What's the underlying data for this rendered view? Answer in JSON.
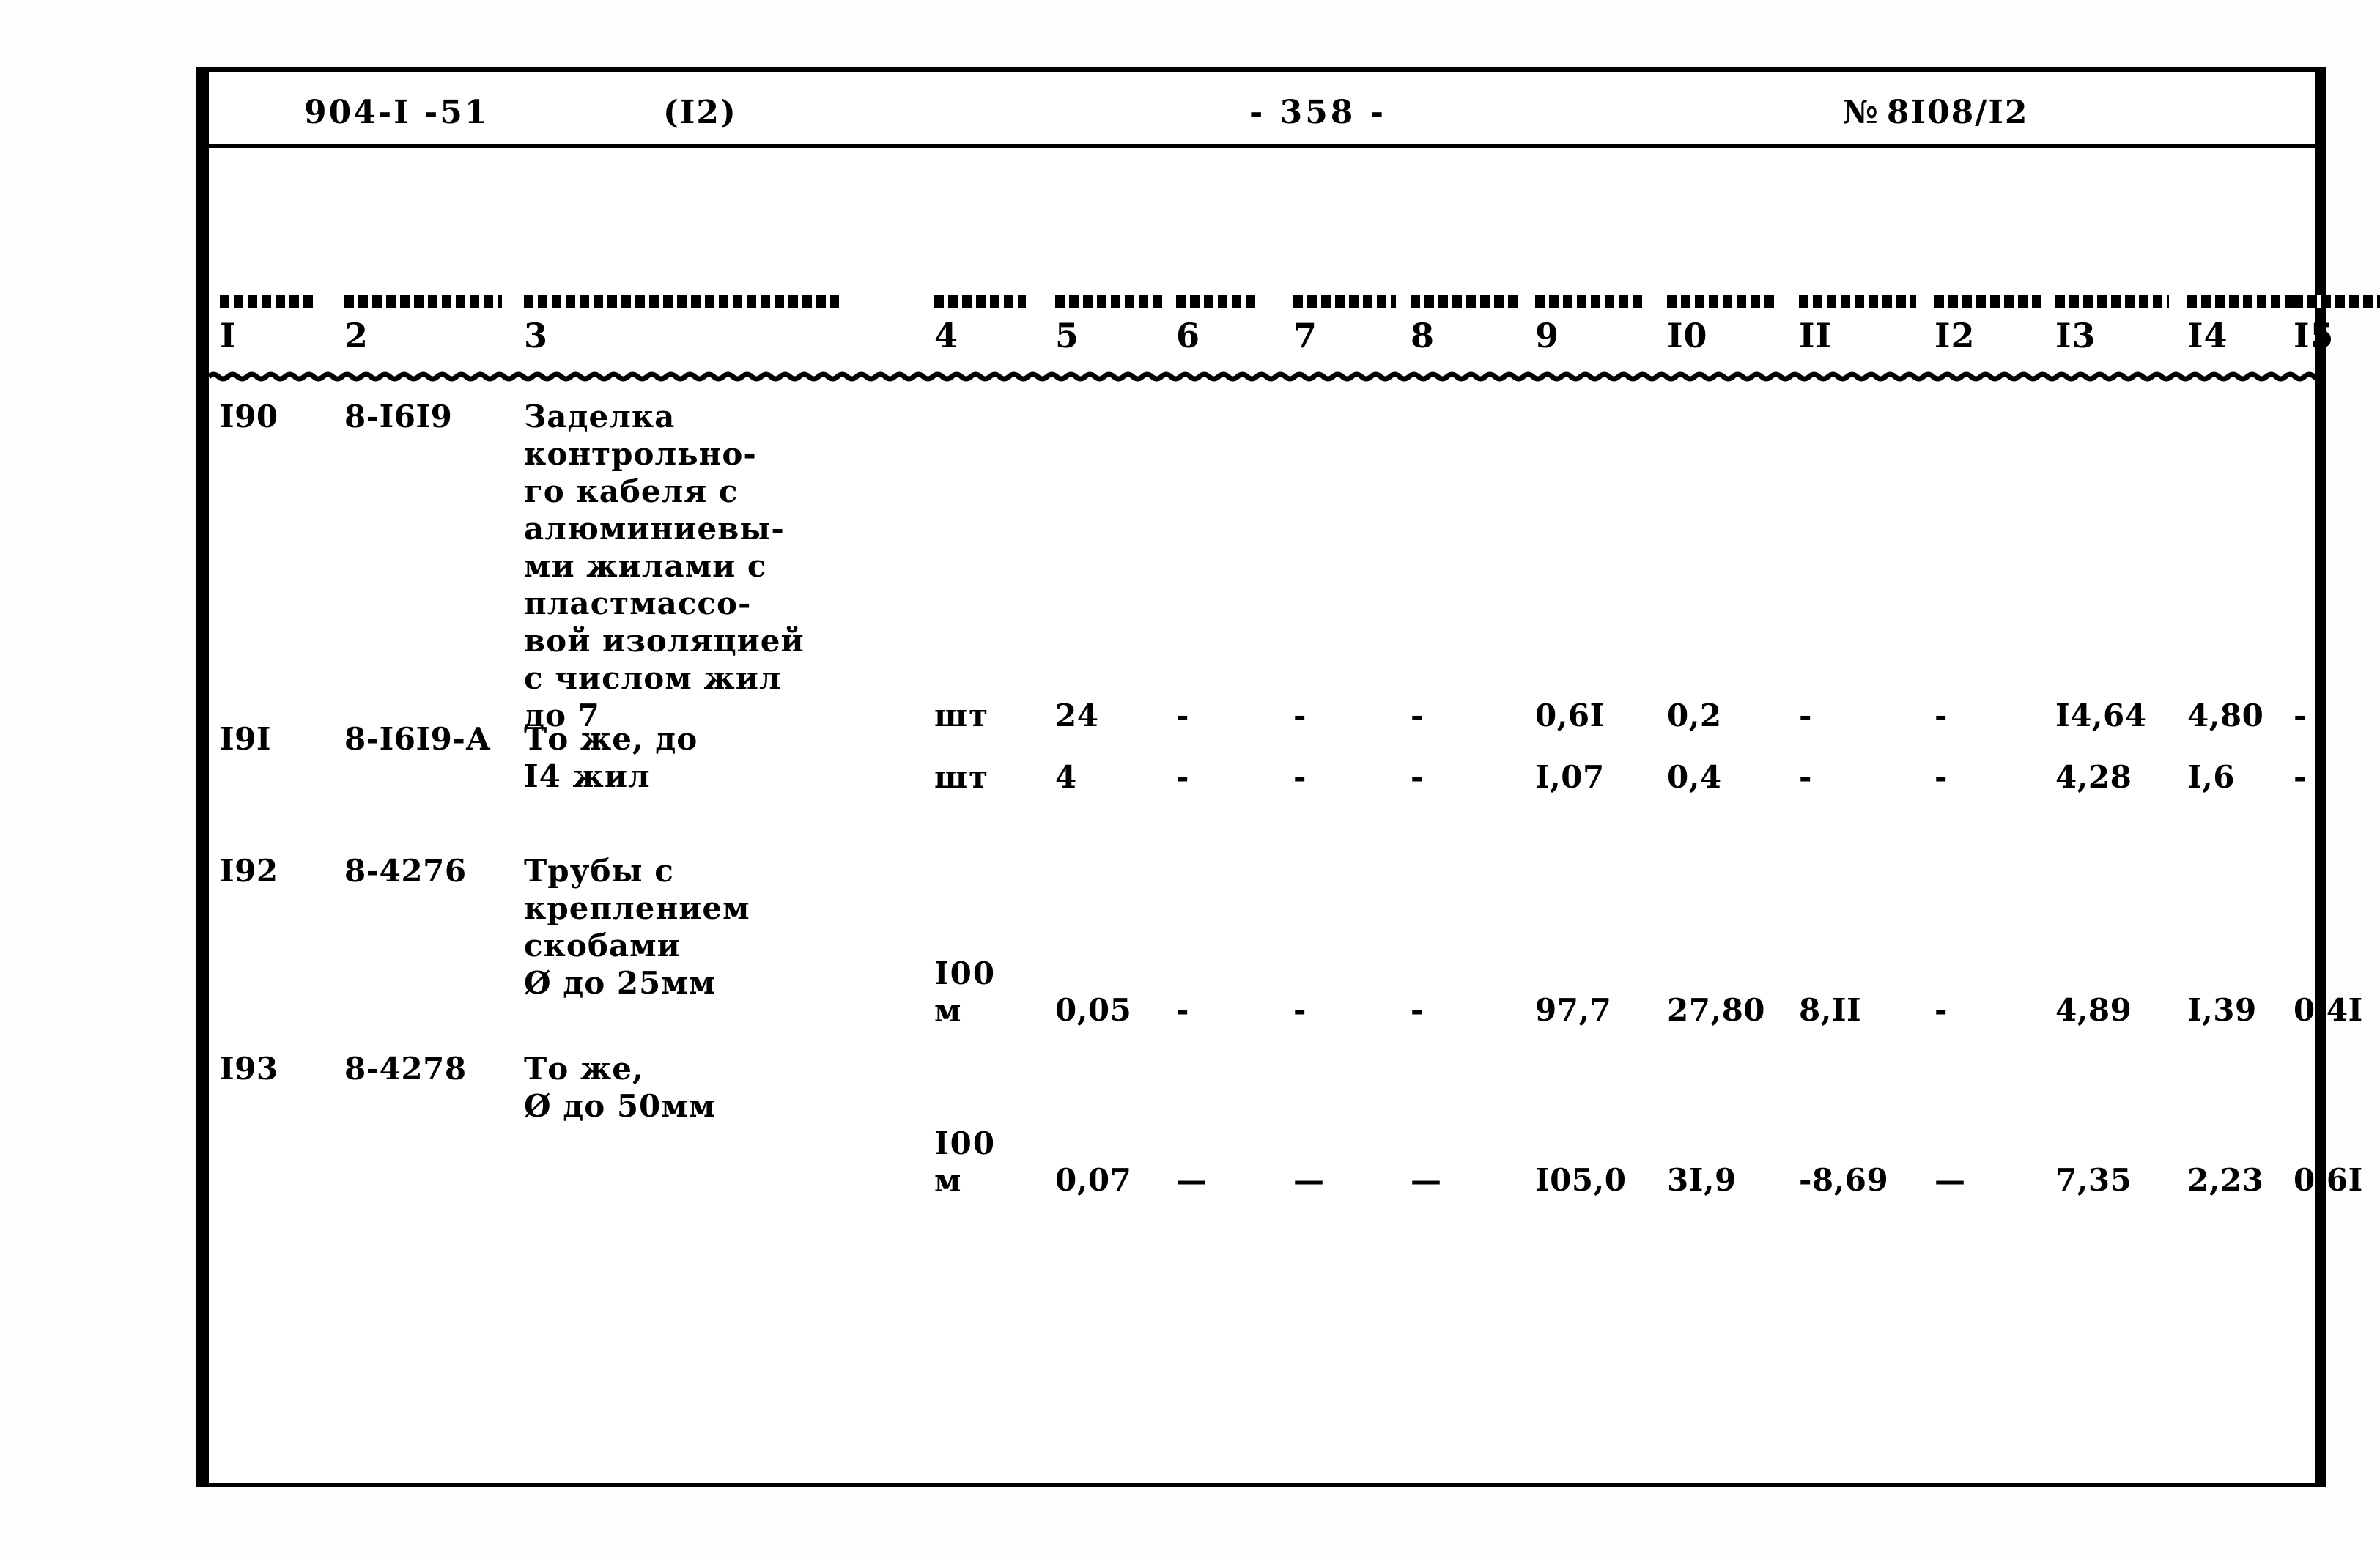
{
  "document": {
    "type": "scanned-typewritten-table",
    "language": "ru",
    "header": {
      "doc_code": "904-I -51",
      "part": "(I2)",
      "page_number": "- 358 -",
      "sheet_number_sign": "№",
      "sheet_number": "8I08/I2"
    },
    "table": {
      "column_numbers": [
        "I",
        "2",
        "3",
        "4",
        "5",
        "6",
        "7",
        "8",
        "9",
        "I0",
        "II",
        "I2",
        "I3",
        "I4",
        "I5"
      ],
      "rows": [
        {
          "c1": "I90",
          "c2": "8-I6I9",
          "c3": "Заделка\nконтрольно-\nго кабеля с\nалюминиевы-\nми жилами с\nпластмассо-\nвой изоляцией\nс числом жил\nдо 7",
          "c4": "шт",
          "c5": "24",
          "c6": "-",
          "c7": "-",
          "c8": "-",
          "c9": "0,6I",
          "c10": "0,2",
          "c11": "-",
          "c12": "-",
          "c13": "I4,64",
          "c14": "4,80",
          "c15": "-"
        },
        {
          "c1": "I9I",
          "c2": "8-I6I9-А",
          "c3": "То же, до\nI4 жил",
          "c4": "шт",
          "c5": "4",
          "c6": "-",
          "c7": "-",
          "c8": "-",
          "c9": "I,07",
          "c10": "0,4",
          "c11": "-",
          "c12": "-",
          "c13": "4,28",
          "c14": "I,6",
          "c15": "-"
        },
        {
          "c1": "I92",
          "c2": "8-4276",
          "c3": "Трубы с\nкреплением\nскобами\nØ до 25мм",
          "c4": "I00\nм",
          "c5": "0,05",
          "c6": "-",
          "c7": "-",
          "c8": "-",
          "c9": "97,7",
          "c10": "27,80",
          "c11": "8,II",
          "c12": "-",
          "c13": "4,89",
          "c14": "I,39",
          "c15": "0,4I"
        },
        {
          "c1": "I93",
          "c2": "8-4278",
          "c3": "То же,\nØ до 50мм",
          "c4": "I00\nм",
          "c5": "0,07",
          "c6": "—",
          "c7": "—",
          "c8": "—",
          "c9": "I05,0",
          "c10": "3I,9",
          "c11": "-8,69",
          "c12": "—",
          "c13": "7,35",
          "c14": "2,23",
          "c15": "0,6I"
        }
      ]
    }
  }
}
